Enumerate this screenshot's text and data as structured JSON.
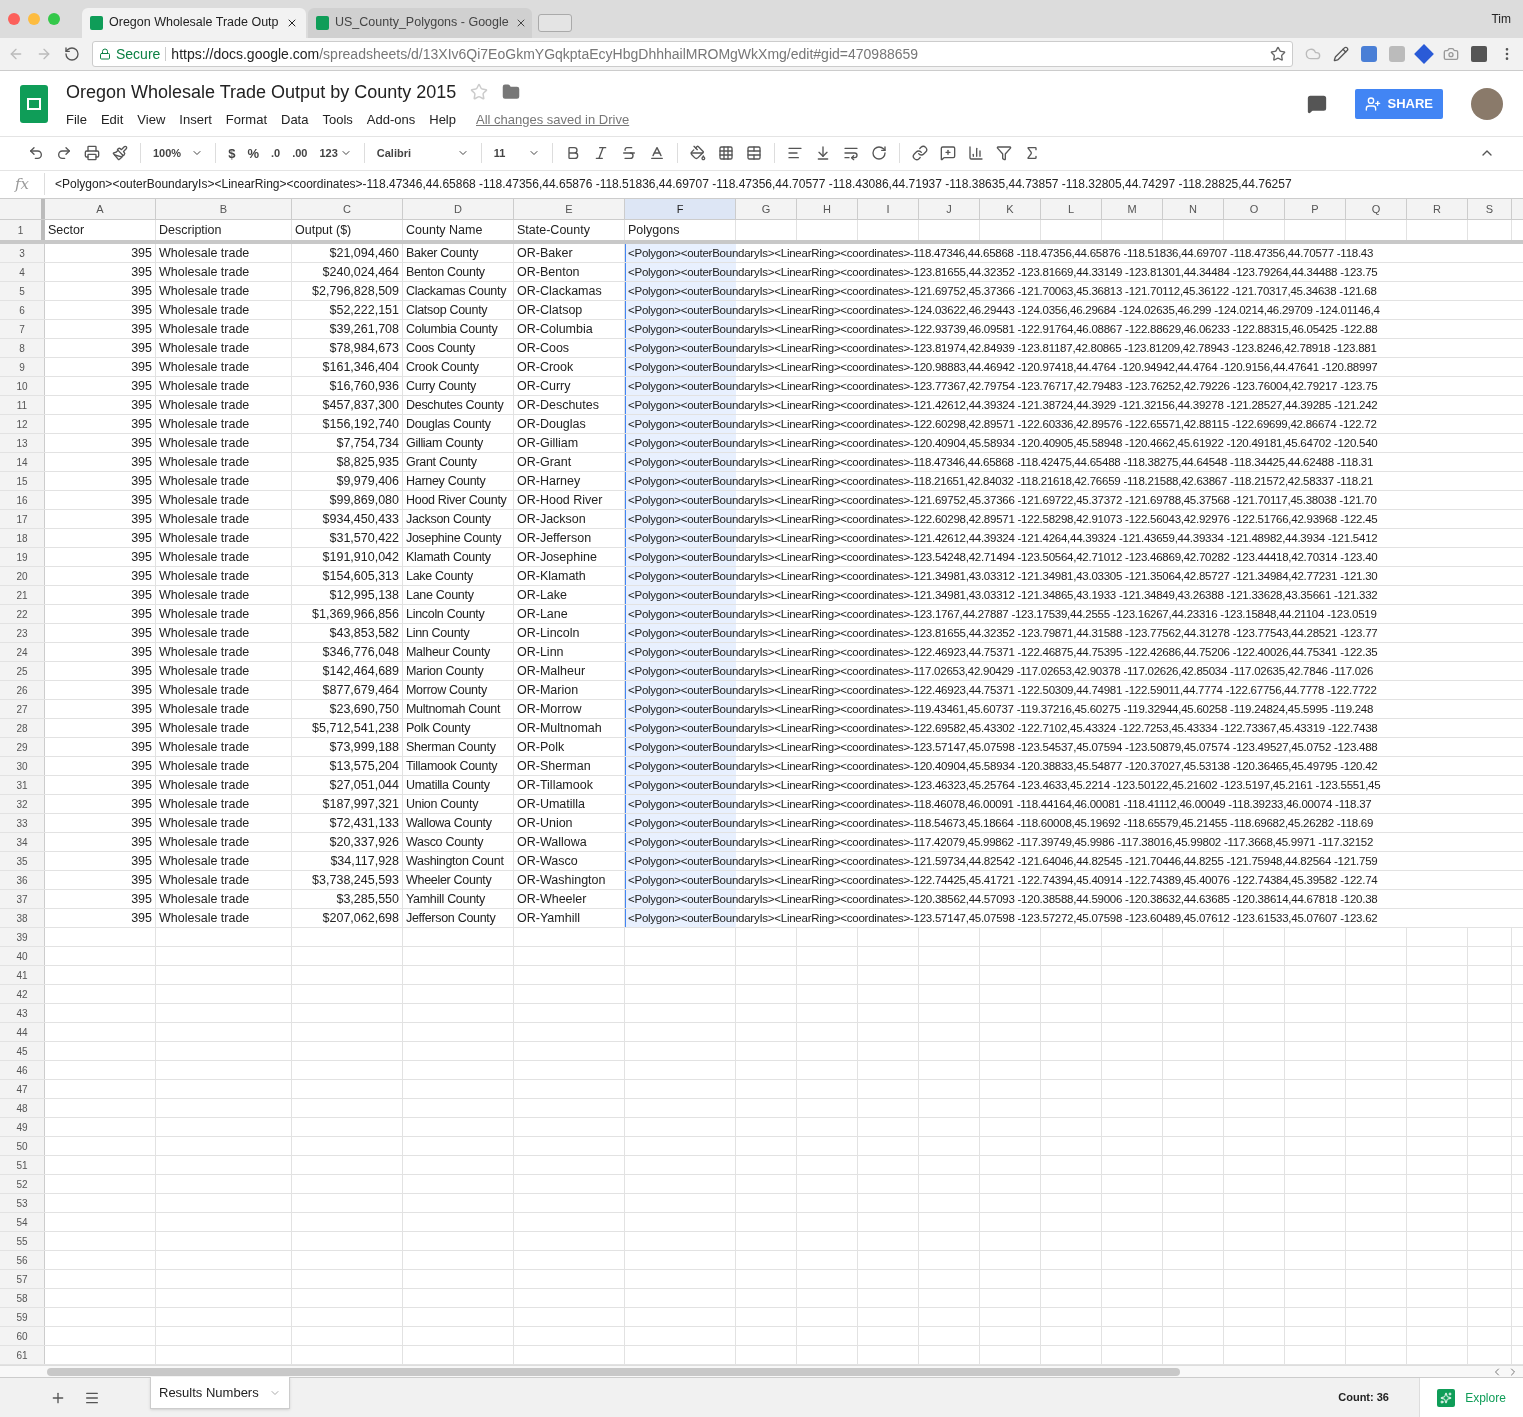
{
  "browser": {
    "tabs": [
      {
        "title": "Oregon Wholesale Trade Outp",
        "selected": true
      },
      {
        "title": "US_County_Polygons - Google",
        "selected": false
      }
    ],
    "user": "Tim",
    "secure_label": "Secure",
    "url_host": "https://docs.google.com",
    "url_path": "/spreadsheets/d/13XIv6Qi7EoGkmYGqkptaEcyHbgDhhhailMROMgWkXmg/edit#gid=470988659"
  },
  "document": {
    "title": "Oregon Wholesale Trade Output by County 2015",
    "menu": [
      "File",
      "Edit",
      "View",
      "Insert",
      "Format",
      "Data",
      "Tools",
      "Add-ons",
      "Help"
    ],
    "save_status": "All changes saved in Drive",
    "share": "SHARE"
  },
  "toolbar": {
    "zoom": "100%",
    "currency": "$",
    "percent": "%",
    "decrease_decimal": ".0",
    "increase_decimal": ".00",
    "number_format": "123",
    "font": "Calibri",
    "font_size": "11"
  },
  "formula_bar": {
    "label": "fx",
    "value": "<Polygon><outerBoundaryIs><LinearRing><coordinates>-118.47346,44.65868 -118.47356,44.65876 -118.51836,44.69707 -118.47356,44.70577 -118.43086,44.71937 -118.38635,44.73857 -118.32805,44.74297 -118.28825,44.76257"
  },
  "columns": [
    {
      "letter": "A",
      "selected": false
    },
    {
      "letter": "B",
      "selected": false
    },
    {
      "letter": "C",
      "selected": false
    },
    {
      "letter": "D",
      "selected": false
    },
    {
      "letter": "E",
      "selected": false
    },
    {
      "letter": "F",
      "selected": true
    },
    {
      "letter": "G",
      "selected": false
    },
    {
      "letter": "H",
      "selected": false
    },
    {
      "letter": "I",
      "selected": false
    },
    {
      "letter": "J",
      "selected": false
    },
    {
      "letter": "K",
      "selected": false
    },
    {
      "letter": "L",
      "selected": false
    },
    {
      "letter": "M",
      "selected": false
    },
    {
      "letter": "N",
      "selected": false
    },
    {
      "letter": "O",
      "selected": false
    },
    {
      "letter": "P",
      "selected": false
    },
    {
      "letter": "Q",
      "selected": false
    },
    {
      "letter": "R",
      "selected": false
    },
    {
      "letter": "S",
      "selected": false
    }
  ],
  "header_row": {
    "number": "1",
    "cells": [
      "Sector",
      "Description",
      "Output ($)",
      "County Name",
      "State-County",
      "Polygons"
    ]
  },
  "rows": [
    {
      "number": "3",
      "sector": "395",
      "description": "Wholesale trade",
      "output": "$21,094,460",
      "county": "Baker County",
      "state_county": "OR-Baker",
      "polygon": "<Polygon><outerBoundaryIs><LinearRing><coordinates>-118.47346,44.65868 -118.47356,44.65876 -118.51836,44.69707 -118.47356,44.70577 -118.43"
    },
    {
      "number": "4",
      "sector": "395",
      "description": "Wholesale trade",
      "output": "$240,024,464",
      "county": "Benton County",
      "state_county": "OR-Benton",
      "polygon": "<Polygon><outerBoundaryIs><LinearRing><coordinates>-123.81655,44.32352 -123.81669,44.33149 -123.81301,44.34484 -123.79264,44.34488 -123.75"
    },
    {
      "number": "5",
      "sector": "395",
      "description": "Wholesale trade",
      "output": "$2,796,828,509",
      "county": "Clackamas County",
      "state_county": "OR-Clackamas",
      "polygon": "<Polygon><outerBoundaryIs><LinearRing><coordinates>-121.69752,45.37366 -121.70063,45.36813 -121.70112,45.36122 -121.70317,45.34638 -121.68"
    },
    {
      "number": "6",
      "sector": "395",
      "description": "Wholesale trade",
      "output": "$52,222,151",
      "county": "Clatsop County",
      "state_county": "OR-Clatsop",
      "polygon": "<Polygon><outerBoundaryIs><LinearRing><coordinates>-124.03622,46.29443 -124.0356,46.29684 -124.02635,46.299 -124.0214,46.29709 -124.01146,4"
    },
    {
      "number": "7",
      "sector": "395",
      "description": "Wholesale trade",
      "output": "$39,261,708",
      "county": "Columbia County",
      "state_county": "OR-Columbia",
      "polygon": "<Polygon><outerBoundaryIs><LinearRing><coordinates>-122.93739,46.09581 -122.91764,46.08867 -122.88629,46.06233 -122.88315,46.05425 -122.88"
    },
    {
      "number": "8",
      "sector": "395",
      "description": "Wholesale trade",
      "output": "$78,984,673",
      "county": "Coos County",
      "state_county": "OR-Coos",
      "polygon": "<Polygon><outerBoundaryIs><LinearRing><coordinates>-123.81974,42.84939 -123.81187,42.80865 -123.81209,42.78943 -123.8246,42.78918 -123.881"
    },
    {
      "number": "9",
      "sector": "395",
      "description": "Wholesale trade",
      "output": "$161,346,404",
      "county": "Crook County",
      "state_county": "OR-Crook",
      "polygon": "<Polygon><outerBoundaryIs><LinearRing><coordinates>-120.98883,44.46942 -120.97418,44.4764 -120.94942,44.4764 -120.9156,44.47641 -120.88997"
    },
    {
      "number": "10",
      "sector": "395",
      "description": "Wholesale trade",
      "output": "$16,760,936",
      "county": "Curry County",
      "state_county": "OR-Curry",
      "polygon": "<Polygon><outerBoundaryIs><LinearRing><coordinates>-123.77367,42.79754 -123.76717,42.79483 -123.76252,42.79226 -123.76004,42.79217 -123.75"
    },
    {
      "number": "11",
      "sector": "395",
      "description": "Wholesale trade",
      "output": "$457,837,300",
      "county": "Deschutes County",
      "state_county": "OR-Deschutes",
      "polygon": "<Polygon><outerBoundaryIs><LinearRing><coordinates>-121.42612,44.39324 -121.38724,44.3929 -121.32156,44.39278 -121.28527,44.39285 -121.242"
    },
    {
      "number": "12",
      "sector": "395",
      "description": "Wholesale trade",
      "output": "$156,192,740",
      "county": "Douglas County",
      "state_county": "OR-Douglas",
      "polygon": "<Polygon><outerBoundaryIs><LinearRing><coordinates>-122.60298,42.89571 -122.60336,42.89576 -122.65571,42.88115 -122.69699,42.86674 -122.72"
    },
    {
      "number": "13",
      "sector": "395",
      "description": "Wholesale trade",
      "output": "$7,754,734",
      "county": "Gilliam County",
      "state_county": "OR-Gilliam",
      "polygon": "<Polygon><outerBoundaryIs><LinearRing><coordinates>-120.40904,45.58934 -120.40905,45.58948 -120.4662,45.61922 -120.49181,45.64702 -120.540"
    },
    {
      "number": "14",
      "sector": "395",
      "description": "Wholesale trade",
      "output": "$8,825,935",
      "county": "Grant County",
      "state_county": "OR-Grant",
      "polygon": "<Polygon><outerBoundaryIs><LinearRing><coordinates>-118.47346,44.65868 -118.42475,44.65488 -118.38275,44.64548 -118.34425,44.62488 -118.31"
    },
    {
      "number": "15",
      "sector": "395",
      "description": "Wholesale trade",
      "output": "$9,979,406",
      "county": "Harney County",
      "state_county": "OR-Harney",
      "polygon": "<Polygon><outerBoundaryIs><LinearRing><coordinates>-118.21651,42.84032 -118.21618,42.76659 -118.21588,42.63867 -118.21572,42.58337 -118.21"
    },
    {
      "number": "16",
      "sector": "395",
      "description": "Wholesale trade",
      "output": "$99,869,080",
      "county": "Hood River County",
      "state_county": "OR-Hood River",
      "polygon": "<Polygon><outerBoundaryIs><LinearRing><coordinates>-121.69752,45.37366 -121.69722,45.37372 -121.69788,45.37568 -121.70117,45.38038 -121.70"
    },
    {
      "number": "17",
      "sector": "395",
      "description": "Wholesale trade",
      "output": "$934,450,433",
      "county": "Jackson County",
      "state_county": "OR-Jackson",
      "polygon": "<Polygon><outerBoundaryIs><LinearRing><coordinates>-122.60298,42.89571 -122.58298,42.91073 -122.56043,42.92976 -122.51766,42.93968 -122.45"
    },
    {
      "number": "18",
      "sector": "395",
      "description": "Wholesale trade",
      "output": "$31,570,422",
      "county": "Josephine County",
      "state_county": "OR-Jefferson",
      "polygon": "<Polygon><outerBoundaryIs><LinearRing><coordinates>-121.42612,44.39324 -121.4264,44.39324 -121.43659,44.39334 -121.48982,44.3934 -121.5412"
    },
    {
      "number": "19",
      "sector": "395",
      "description": "Wholesale trade",
      "output": "$191,910,042",
      "county": "Klamath County",
      "state_county": "OR-Josephine",
      "polygon": "<Polygon><outerBoundaryIs><LinearRing><coordinates>-123.54248,42.71494 -123.50564,42.71012 -123.46869,42.70282 -123.44418,42.70314 -123.40"
    },
    {
      "number": "20",
      "sector": "395",
      "description": "Wholesale trade",
      "output": "$154,605,313",
      "county": "Lake County",
      "state_county": "OR-Klamath",
      "polygon": "<Polygon><outerBoundaryIs><LinearRing><coordinates>-121.34981,43.03312 -121.34981,43.03305 -121.35064,42.85727 -121.34984,42.77231 -121.30"
    },
    {
      "number": "21",
      "sector": "395",
      "description": "Wholesale trade",
      "output": "$12,995,138",
      "county": "Lane County",
      "state_county": "OR-Lake",
      "polygon": "<Polygon><outerBoundaryIs><LinearRing><coordinates>-121.34981,43.03312 -121.34865,43.1933 -121.34849,43.26388 -121.33628,43.35661 -121.332"
    },
    {
      "number": "22",
      "sector": "395",
      "description": "Wholesale trade",
      "output": "$1,369,966,856",
      "county": "Lincoln County",
      "state_county": "OR-Lane",
      "polygon": "<Polygon><outerBoundaryIs><LinearRing><coordinates>-123.1767,44.27887 -123.17539,44.2555 -123.16267,44.23316 -123.15848,44.21104 -123.0519"
    },
    {
      "number": "23",
      "sector": "395",
      "description": "Wholesale trade",
      "output": "$43,853,582",
      "county": "Linn County",
      "state_county": "OR-Lincoln",
      "polygon": "<Polygon><outerBoundaryIs><LinearRing><coordinates>-123.81655,44.32352 -123.79871,44.31588 -123.77562,44.31278 -123.77543,44.28521 -123.77"
    },
    {
      "number": "24",
      "sector": "395",
      "description": "Wholesale trade",
      "output": "$346,776,048",
      "county": "Malheur County",
      "state_county": "OR-Linn",
      "polygon": "<Polygon><outerBoundaryIs><LinearRing><coordinates>-122.46923,44.75371 -122.46875,44.75395 -122.42686,44.75206 -122.40026,44.75341 -122.35"
    },
    {
      "number": "25",
      "sector": "395",
      "description": "Wholesale trade",
      "output": "$142,464,689",
      "county": "Marion County",
      "state_county": "OR-Malheur",
      "polygon": "<Polygon><outerBoundaryIs><LinearRing><coordinates>-117.02653,42.90429 -117.02653,42.90378 -117.02626,42.85034 -117.02635,42.7846 -117.026"
    },
    {
      "number": "26",
      "sector": "395",
      "description": "Wholesale trade",
      "output": "$877,679,464",
      "county": "Morrow County",
      "state_county": "OR-Marion",
      "polygon": "<Polygon><outerBoundaryIs><LinearRing><coordinates>-122.46923,44.75371 -122.50309,44.74981 -122.59011,44.7774 -122.67756,44.7778 -122.7722"
    },
    {
      "number": "27",
      "sector": "395",
      "description": "Wholesale trade",
      "output": "$23,690,750",
      "county": "Multnomah Count",
      "state_county": "OR-Morrow",
      "polygon": "<Polygon><outerBoundaryIs><LinearRing><coordinates>-119.43461,45.60737 -119.37216,45.60275 -119.32944,45.60258 -119.24824,45.5995 -119.248"
    },
    {
      "number": "28",
      "sector": "395",
      "description": "Wholesale trade",
      "output": "$5,712,541,238",
      "county": "Polk County",
      "state_county": "OR-Multnomah",
      "polygon": "<Polygon><outerBoundaryIs><LinearRing><coordinates>-122.69582,45.43302 -122.7102,45.43324 -122.7253,45.43334 -122.73367,45.43319 -122.7438"
    },
    {
      "number": "29",
      "sector": "395",
      "description": "Wholesale trade",
      "output": "$73,999,188",
      "county": "Sherman County",
      "state_county": "OR-Polk",
      "polygon": "<Polygon><outerBoundaryIs><LinearRing><coordinates>-123.57147,45.07598 -123.54537,45.07594 -123.50879,45.07574 -123.49527,45.0752 -123.488"
    },
    {
      "number": "30",
      "sector": "395",
      "description": "Wholesale trade",
      "output": "$13,575,204",
      "county": "Tillamook County",
      "state_county": "OR-Sherman",
      "polygon": "<Polygon><outerBoundaryIs><LinearRing><coordinates>-120.40904,45.58934 -120.38833,45.54877 -120.37027,45.53138 -120.36465,45.49795 -120.42"
    },
    {
      "number": "31",
      "sector": "395",
      "description": "Wholesale trade",
      "output": "$27,051,044",
      "county": "Umatilla County",
      "state_county": "OR-Tillamook",
      "polygon": "<Polygon><outerBoundaryIs><LinearRing><coordinates>-123.46323,45.25764 -123.4633,45.2214 -123.50122,45.21602 -123.5197,45.2161 -123.5551,45"
    },
    {
      "number": "32",
      "sector": "395",
      "description": "Wholesale trade",
      "output": "$187,997,321",
      "county": "Union County",
      "state_county": "OR-Umatilla",
      "polygon": "<Polygon><outerBoundaryIs><LinearRing><coordinates>-118.46078,46.00091 -118.44164,46.00081 -118.41112,46.00049 -118.39233,46.00074 -118.37"
    },
    {
      "number": "33",
      "sector": "395",
      "description": "Wholesale trade",
      "output": "$72,431,133",
      "county": "Wallowa County",
      "state_county": "OR-Union",
      "polygon": "<Polygon><outerBoundaryIs><LinearRing><coordinates>-118.54673,45.18664 -118.60008,45.19692 -118.65579,45.21455 -118.69682,45.26282 -118.69"
    },
    {
      "number": "34",
      "sector": "395",
      "description": "Wholesale trade",
      "output": "$20,337,926",
      "county": "Wasco County",
      "state_county": "OR-Wallowa",
      "polygon": "<Polygon><outerBoundaryIs><LinearRing><coordinates>-117.42079,45.99862 -117.39749,45.9986 -117.38016,45.99802 -117.3668,45.9971 -117.32152"
    },
    {
      "number": "35",
      "sector": "395",
      "description": "Wholesale trade",
      "output": "$34,117,928",
      "county": "Washington Count",
      "state_county": "OR-Wasco",
      "polygon": "<Polygon><outerBoundaryIs><LinearRing><coordinates>-121.59734,44.82542 -121.64046,44.82545 -121.70446,44.8255 -121.75948,44.82564 -121.759"
    },
    {
      "number": "36",
      "sector": "395",
      "description": "Wholesale trade",
      "output": "$3,738,245,593",
      "county": "Wheeler County",
      "state_county": "OR-Washington",
      "polygon": "<Polygon><outerBoundaryIs><LinearRing><coordinates>-122.74425,45.41721 -122.74394,45.40914 -122.74389,45.40076 -122.74384,45.39582 -122.74"
    },
    {
      "number": "37",
      "sector": "395",
      "description": "Wholesale trade",
      "output": "$3,285,550",
      "county": "Yamhill County",
      "state_county": "OR-Wheeler",
      "polygon": "<Polygon><outerBoundaryIs><LinearRing><coordinates>-120.38562,44.57093 -120.38588,44.59006 -120.38632,44.63685 -120.38614,44.67818 -120.38"
    },
    {
      "number": "38",
      "sector": "395",
      "description": "Wholesale trade",
      "output": "$207,062,698",
      "county": "Jefferson County",
      "state_county": "OR-Yamhill",
      "polygon": "<Polygon><outerBoundaryIs><LinearRing><coordinates>-123.57147,45.07598 -123.57272,45.07598 -123.60489,45.07612 -123.61533,45.07607 -123.62"
    }
  ],
  "empty_rows": [
    "39",
    "40",
    "41",
    "42",
    "43",
    "44",
    "45",
    "46",
    "47",
    "48",
    "49",
    "50",
    "51",
    "52",
    "53",
    "54",
    "55",
    "56",
    "57",
    "58",
    "59",
    "60",
    "61"
  ],
  "sheet_tabs": [
    {
      "name": "Results Numbers",
      "selected": true
    }
  ],
  "status": {
    "summary": "Count: 36",
    "explore": "Explore"
  }
}
